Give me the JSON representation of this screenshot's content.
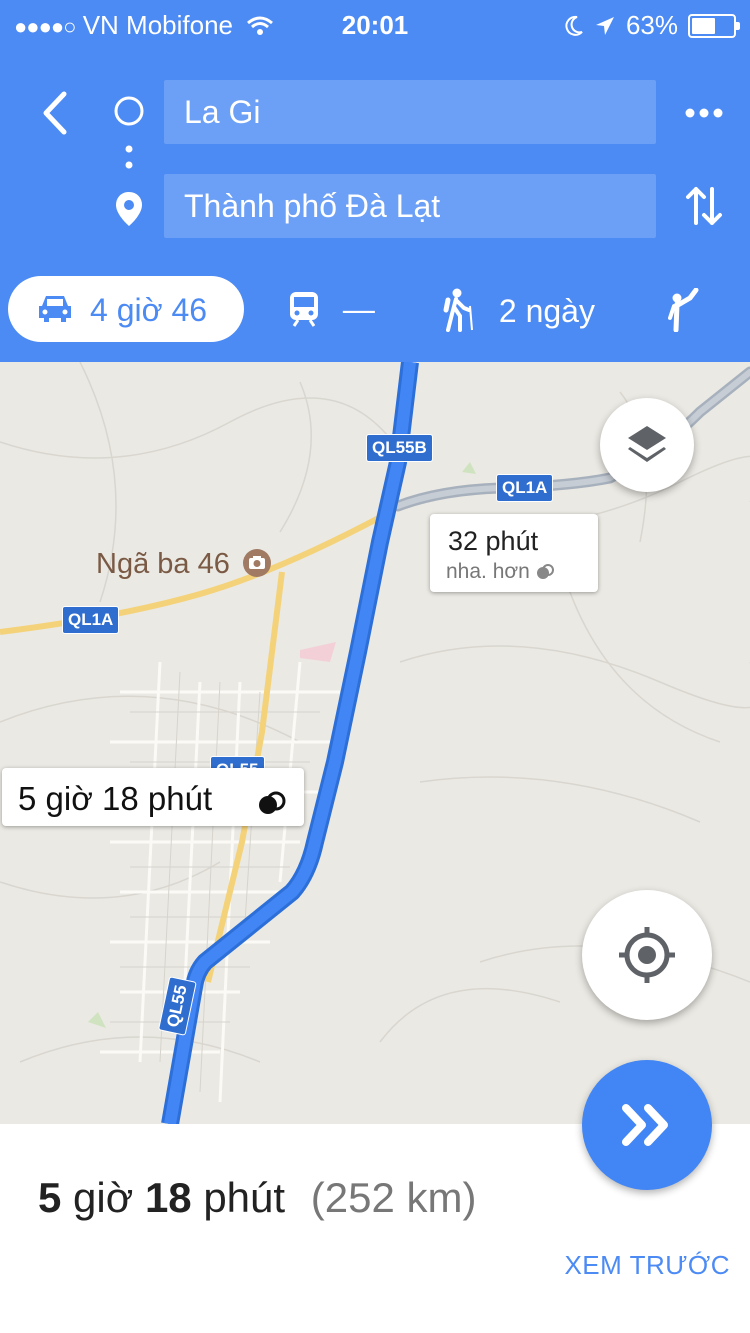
{
  "status_bar": {
    "signal": "●●●●○",
    "carrier": "VN Mobifone",
    "time": "20:01",
    "battery_text": "63%",
    "battery_level": 0.63
  },
  "route": {
    "origin": "La Gi",
    "destination": "Thành phố Đà Lạt"
  },
  "modes": {
    "car": "4 giờ 46",
    "transit": "—",
    "walk": "2 ngày"
  },
  "map": {
    "road_labels": {
      "ql55b": "QL55B",
      "ql1a_east": "QL1A",
      "ql1a_west": "QL1A",
      "ql55_mid": "QL55",
      "ql55_south": "QL55"
    },
    "place": "Ngã ba 46",
    "alt_route": {
      "time": "32 phút",
      "note": "nha. hơn"
    },
    "main_route_label": "5 giờ 18 phút"
  },
  "summary": {
    "duration_h": "5",
    "duration_h_unit": "giờ",
    "duration_m": "18",
    "duration_m_unit": "phút",
    "distance": "(252 km)"
  },
  "preview_label": "XEM TRƯỚC",
  "colors": {
    "header": "#4c8af4",
    "route": "#4285f4",
    "alt_route": "#a7b1bd",
    "road_yellow": "#f4d27a"
  }
}
